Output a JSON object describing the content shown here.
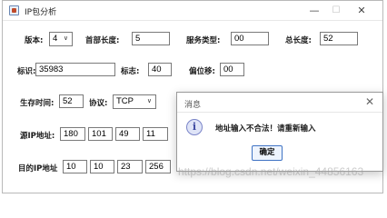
{
  "window": {
    "title": "IP包分析",
    "minimize_glyph": "—",
    "maximize_glyph": "☐",
    "close_glyph": "✕"
  },
  "labels": {
    "version": "版本:",
    "header_length": "首部长度:",
    "service_type": "服务类型:",
    "total_length": "总长度:",
    "identification": "标识:",
    "flags": "标志:",
    "fragment_offset": "偏位移:",
    "ttl": "生存时间:",
    "protocol": "协议:",
    "source_ip": "源IP地址:",
    "dest_ip": "目的IP地址"
  },
  "fields": {
    "version": "4",
    "header_length": "5",
    "service_type": "00",
    "total_length": "52",
    "identification": "35983",
    "flags": "40",
    "fragment_offset": "00",
    "ttl": "52",
    "protocol": "TCP",
    "source_ip": [
      "180",
      "101",
      "49",
      "11"
    ],
    "dest_ip": [
      "10",
      "10",
      "23",
      "256"
    ]
  },
  "dialog": {
    "title": "消息",
    "close_glyph": "✕",
    "message": "地址输入不合法！请重新输入",
    "ok_label": "确定",
    "icon": "info-icon"
  },
  "watermark": "https://blog.csdn.net/weixin_44856163"
}
